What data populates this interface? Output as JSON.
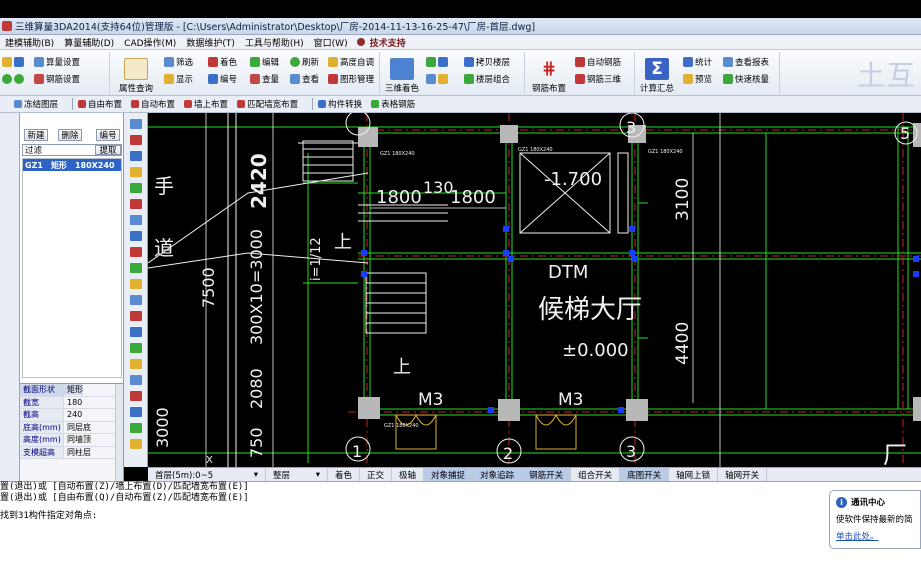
{
  "window": {
    "title": "三维算量3DA2014(支持64位)管理版 - [C:\\Users\\Administrator\\Desktop\\厂房-2014-11-13-16-25-47\\厂房-首层.dwg]"
  },
  "menu": [
    "建模辅助(B)",
    "算量辅助(D)",
    "CAD操作(M)",
    "数据维护(T)",
    "工具与帮助(H)",
    "窗口(W)"
  ],
  "menu_special": "技术支持",
  "ribbon": {
    "small": [
      "算量设置",
      "钢筋设置",
      "属性查询",
      "筛选",
      "显示",
      "着色",
      "编号",
      "编辑",
      "查量",
      "刷新",
      "查看",
      "高度自调",
      "图形管理",
      "拷贝楼层",
      "楼层组合",
      "自动钢筋",
      "钢筋三维",
      "统计",
      "预览",
      "查看报表",
      "快速核量"
    ],
    "big": [
      "三维着色",
      "钢筋布置",
      "计算汇总"
    ]
  },
  "toolbar2": [
    "冻结图层",
    "自由布置",
    "自动布置",
    "墙上布置",
    "匹配墙宽布置",
    "构件转换",
    "表格钢筋"
  ],
  "left_panel": {
    "buttons": [
      "新建",
      "删除",
      "编号"
    ],
    "extract_button": "提取",
    "filter_label": "过滤",
    "list": [
      {
        "code": "GZ1",
        "shape": "矩形",
        "size": "180X240"
      }
    ],
    "props_head": [
      "截面形状",
      "矩形"
    ],
    "props": [
      [
        "截宽",
        "180"
      ],
      [
        "截高",
        "240"
      ],
      [
        "底高(mm)",
        "同层底"
      ],
      [
        "高度(mm)",
        "同墙顶"
      ],
      [
        "支模超高",
        "同柱层"
      ]
    ]
  },
  "status": {
    "floor": "首层(5m):0~5",
    "floor_mode": "整层",
    "items": [
      {
        "label": "着色",
        "on": false
      },
      {
        "label": "正交",
        "on": false
      },
      {
        "label": "极轴",
        "on": false
      },
      {
        "label": "对象捕捉",
        "on": true
      },
      {
        "label": "对象追踪",
        "on": true
      },
      {
        "label": "钢筋开关",
        "on": true
      },
      {
        "label": "组合开关",
        "on": false
      },
      {
        "label": "底图开关",
        "on": true
      },
      {
        "label": "轴网上锁",
        "on": false
      },
      {
        "label": "轴网开关",
        "on": false
      }
    ]
  },
  "command": {
    "lines": [
      "置(退出)或 [自动布置(Z)/墙上布置(D)/匹配墙宽布置(E)]",
      "置(退出)或 [自由布置(Q)/自动布置(Z)/匹配墙宽布置(E)]",
      "找到31构件指定对角点:"
    ]
  },
  "notify": {
    "title": "通讯中心",
    "body": "使软件保持最新的简",
    "link": "单击此处。"
  },
  "cad": {
    "dims": [
      "2420",
      "7500",
      "2080",
      "300X10=3000",
      "1800",
      "130",
      "1800",
      "3100",
      "4400",
      "750",
      "3000"
    ],
    "texts": [
      "手",
      "道",
      "上",
      "上",
      "-1.700",
      "DTM",
      "候梯大厅",
      "±0.000",
      "M3",
      "M3",
      "i=1/12"
    ],
    "axes": [
      "1",
      "2",
      "3",
      "3",
      "5"
    ],
    "small_labels": [
      "GZ1 180X240",
      "GZ1 180X240",
      "GZ1 180X240",
      "GZ1 180X240"
    ],
    "corner": "厂",
    "ucs": "X"
  },
  "colors": {
    "accent": "#2d63c4",
    "cad_green": "#22dd22",
    "cad_white": "#f0f0f0",
    "cad_red": "#dd2222",
    "cad_blue": "#1a3cff"
  }
}
